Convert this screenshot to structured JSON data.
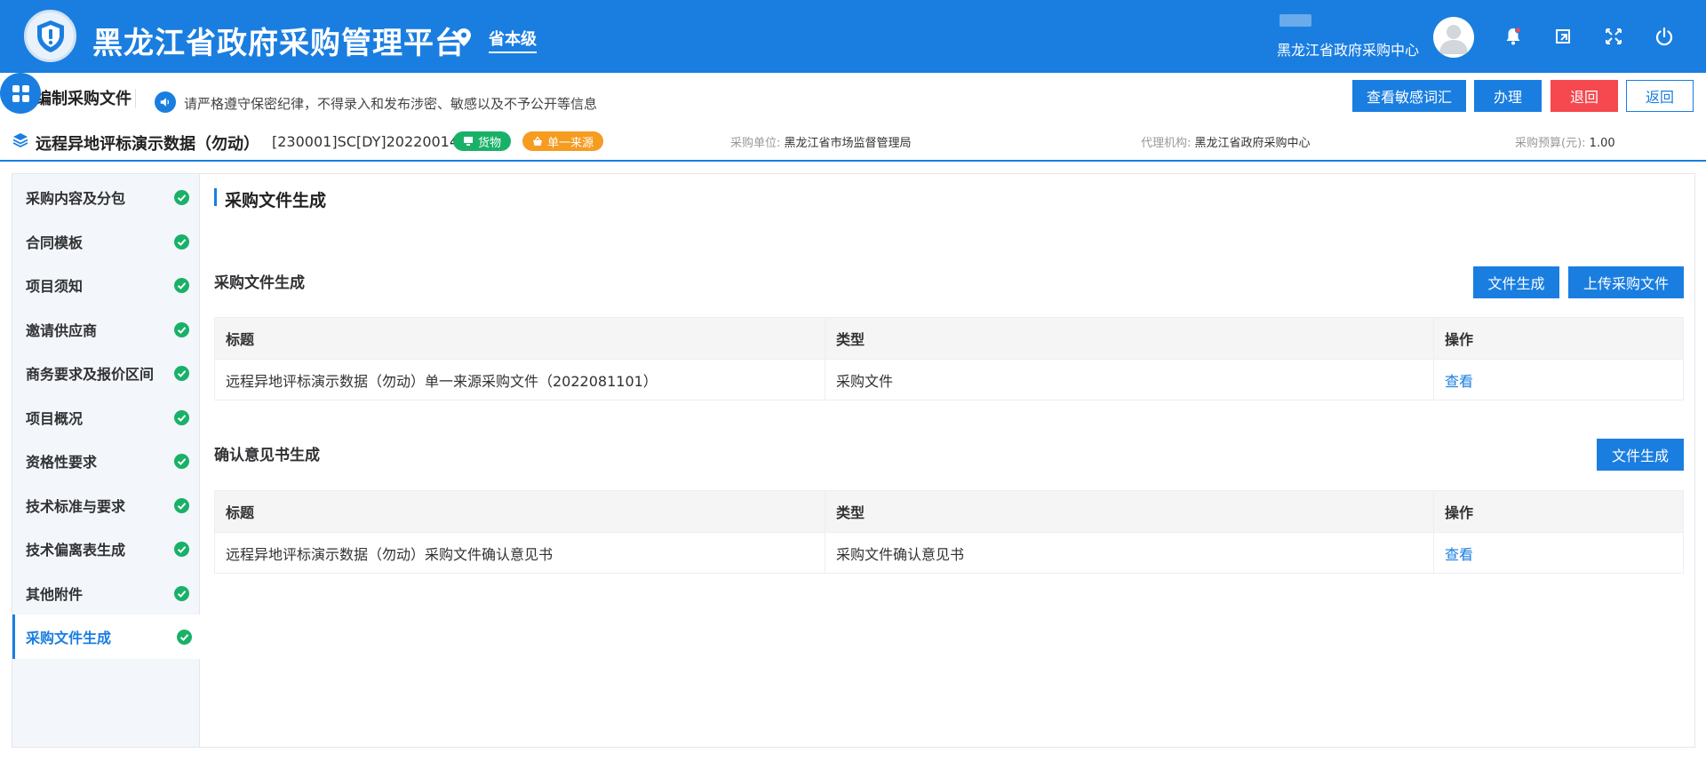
{
  "header": {
    "app_title": "黑龙江省政府采购管理平台",
    "region": "省本级",
    "user_org": "黑龙江省政府采购中心"
  },
  "toolbar": {
    "page_name": "编制采购文件",
    "notice": "请严格遵守保密纪律，不得录入和发布涉密、敏感以及不予公开等信息",
    "buttons": {
      "sensitive": "查看敏感词汇",
      "handle": "办理",
      "reject": "退回",
      "back": "返回"
    }
  },
  "project": {
    "name": "远程异地评标演示数据（勿动）",
    "code": "[230001]SC[DY]20220014",
    "tag_goods": "货物",
    "tag_source": "单一来源",
    "buyer_label": "采购单位:",
    "buyer_value": "黑龙江省市场监督管理局",
    "agency_label": "代理机构:",
    "agency_value": "黑龙江省政府采购中心",
    "budget_label": "采购预算(元):",
    "budget_value": "1.00"
  },
  "sidebar": {
    "items": [
      {
        "label": "采购内容及分包"
      },
      {
        "label": "合同模板"
      },
      {
        "label": "项目须知"
      },
      {
        "label": "邀请供应商"
      },
      {
        "label": "商务要求及报价区间"
      },
      {
        "label": "项目概况"
      },
      {
        "label": "资格性要求"
      },
      {
        "label": "技术标准与要求"
      },
      {
        "label": "技术偏离表生成"
      },
      {
        "label": "其他附件"
      },
      {
        "label": "采购文件生成"
      }
    ]
  },
  "main": {
    "section_title": "采购文件生成",
    "procurement": {
      "title": "采购文件生成",
      "btn_generate": "文件生成",
      "btn_upload": "上传采购文件",
      "headers": {
        "title": "标题",
        "type": "类型",
        "action": "操作"
      },
      "rows": [
        {
          "title": "远程异地评标演示数据（勿动）单一来源采购文件（2022081101）",
          "type": "采购文件",
          "action": "查看"
        }
      ]
    },
    "confirmation": {
      "title": "确认意见书生成",
      "btn_generate": "文件生成",
      "headers": {
        "title": "标题",
        "type": "类型",
        "action": "操作"
      },
      "rows": [
        {
          "title": "远程异地评标演示数据（勿动）采购文件确认意见书",
          "type": "采购文件确认意见书",
          "action": "查看"
        }
      ]
    }
  },
  "colors": {
    "primary": "#1a7ee0",
    "danger": "#f5484f",
    "success": "#19b168",
    "warning": "#f59c21"
  }
}
